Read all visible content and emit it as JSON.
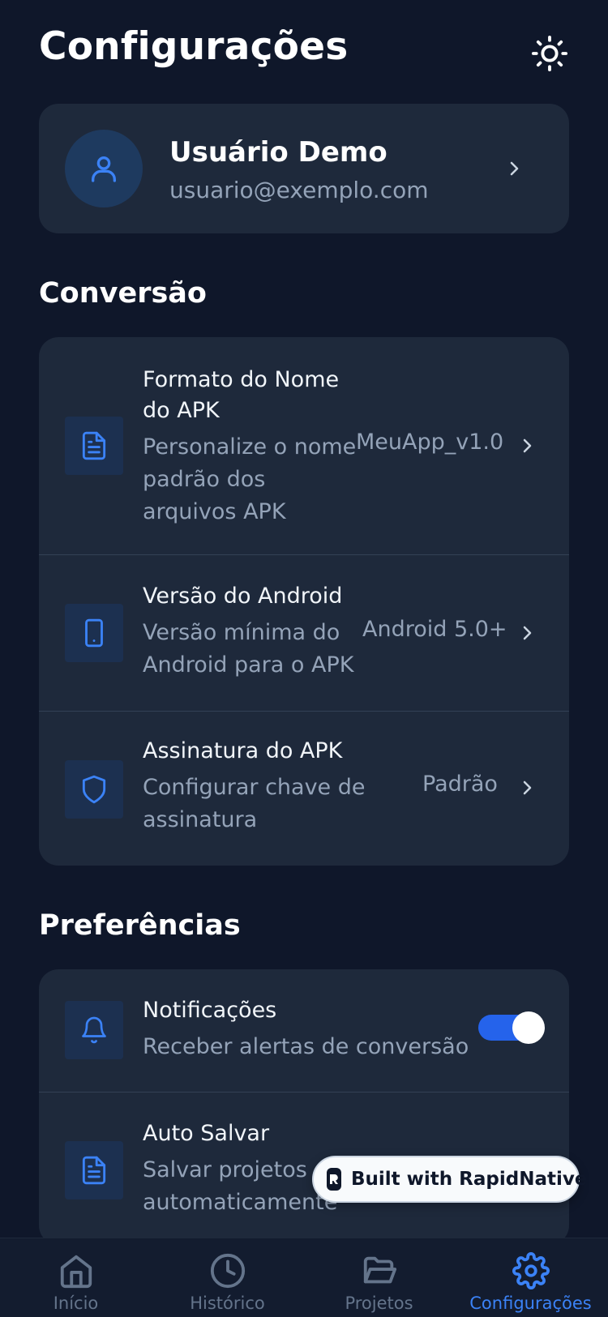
{
  "header": {
    "title": "Configurações",
    "theme_icon": "sun-icon"
  },
  "profile": {
    "name": "Usuário Demo",
    "email": "usuario@exemplo.com",
    "avatar_icon": "user-icon"
  },
  "sections": {
    "conversion": {
      "title": "Conversão",
      "items": [
        {
          "title_line1": "Formato do Nome",
          "title_line2": "do APK",
          "desc_line1": "Personalize o nome",
          "desc_line2": "padrão dos",
          "desc_line3": "arquivos APK",
          "value": "MeuApp_v1.0",
          "icon": "file-icon"
        },
        {
          "title": "Versão do Android",
          "desc_line1": "Versão mínima do",
          "desc_line2": "Android para o APK",
          "value": "Android 5.0+",
          "icon": "phone-icon"
        },
        {
          "title": "Assinatura do APK",
          "desc_line1": "Configurar chave de",
          "desc_line2": "assinatura",
          "value": "Padrão",
          "icon": "shield-icon"
        }
      ]
    },
    "preferences": {
      "title": "Preferências",
      "items": [
        {
          "title": "Notificações",
          "desc": "Receber alertas de conversão",
          "toggle_on": true,
          "icon": "bell-icon"
        },
        {
          "title": "Auto Salvar",
          "desc_line1": "Salvar projetos",
          "desc_line2": "automaticamente",
          "icon": "file-icon"
        }
      ]
    }
  },
  "badge": {
    "text": "Built with RapidNative"
  },
  "tabs": [
    {
      "label": "Início",
      "icon": "home-icon",
      "active": false
    },
    {
      "label": "Histórico",
      "icon": "clock-icon",
      "active": false
    },
    {
      "label": "Projetos",
      "icon": "folder-icon",
      "active": false
    },
    {
      "label": "Configurações",
      "icon": "gear-icon",
      "active": true
    }
  ],
  "colors": {
    "background": "#0f172a",
    "card": "#1e293b",
    "accent": "#3b82f6",
    "muted": "#94a3b8"
  }
}
